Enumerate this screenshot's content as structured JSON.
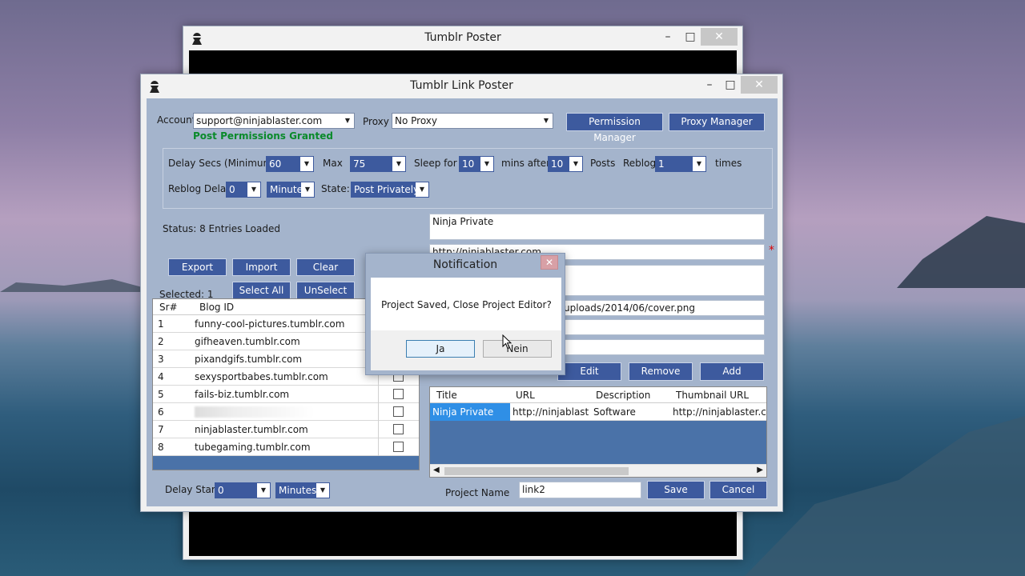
{
  "back_window": {
    "title": "Tumblr Poster",
    "min": "–",
    "max": "□",
    "close": "✕"
  },
  "main_window": {
    "title": "Tumblr Link Poster",
    "min": "–",
    "max": "□",
    "close": "✕"
  },
  "account": {
    "label": "Account",
    "value": "support@ninjablaster.com",
    "permission_status": "Post Permissions Granted"
  },
  "proxy": {
    "label": "Proxy",
    "value": "No Proxy"
  },
  "buttons": {
    "permission_manager": "Permission Manager",
    "proxy_manager": "Proxy Manager",
    "export": "Export",
    "import": "Import",
    "clear": "Clear",
    "select_all": "Select All",
    "unselect": "UnSelect",
    "edit": "Edit",
    "remove": "Remove",
    "add": "Add",
    "save": "Save",
    "cancel": "Cancel"
  },
  "delay": {
    "delay_label": "Delay Secs (Minimum)",
    "delay_value": "60",
    "max_label": "Max",
    "max_value": "75",
    "sleep_label": "Sleep for",
    "sleep_value": "10",
    "mins_after_label": "mins after",
    "mins_after_value": "10",
    "posts_label": "Posts",
    "reblog_label": "Reblog",
    "reblog_value": "1",
    "times_label": "times",
    "reblog_delay_label": "Reblog Delay",
    "reblog_delay_value": "0",
    "reblog_delay_unit": "Minutes",
    "state_label": "State:",
    "state_value": "Post Privately"
  },
  "status": "Status:  8 Entries Loaded",
  "selected": "Selected:  1",
  "blog_table": {
    "headers": [
      "Sr#",
      "Blog ID"
    ],
    "rows": [
      {
        "sr": "1",
        "blog": "funny-cool-pictures.tumblr.com"
      },
      {
        "sr": "2",
        "blog": "gifheaven.tumblr.com"
      },
      {
        "sr": "3",
        "blog": "pixandgifs.tumblr.com"
      },
      {
        "sr": "4",
        "blog": "sexysportbabes.tumblr.com"
      },
      {
        "sr": "5",
        "blog": "fails-biz.tumblr.com"
      },
      {
        "sr": "6",
        "blog": ""
      },
      {
        "sr": "7",
        "blog": "ninjablaster.tumblr.com"
      },
      {
        "sr": "8",
        "blog": "tubegaming.tumblr.com"
      }
    ]
  },
  "delay_start": {
    "label": "Delay Start",
    "value": "0",
    "unit": "Minutes"
  },
  "form": {
    "title_value": "Ninja Private",
    "url_value": "http://ninjablaster.com",
    "thumb_value": "/uploads/2014/06/cover.png",
    "required_mark": "*"
  },
  "link_table": {
    "headers": [
      "Title",
      "URL",
      "Description",
      "Thumbnail URL"
    ],
    "row": [
      "Ninja Private",
      "http://ninjablaste...",
      "Software",
      "http://ninjablaster.com/v"
    ]
  },
  "project": {
    "label": "Project Name",
    "value": "link2"
  },
  "dialog": {
    "title": "Notification",
    "message": "Project Saved, Close Project Editor?",
    "yes": "Ja",
    "no": "Nein",
    "close": "✕"
  }
}
